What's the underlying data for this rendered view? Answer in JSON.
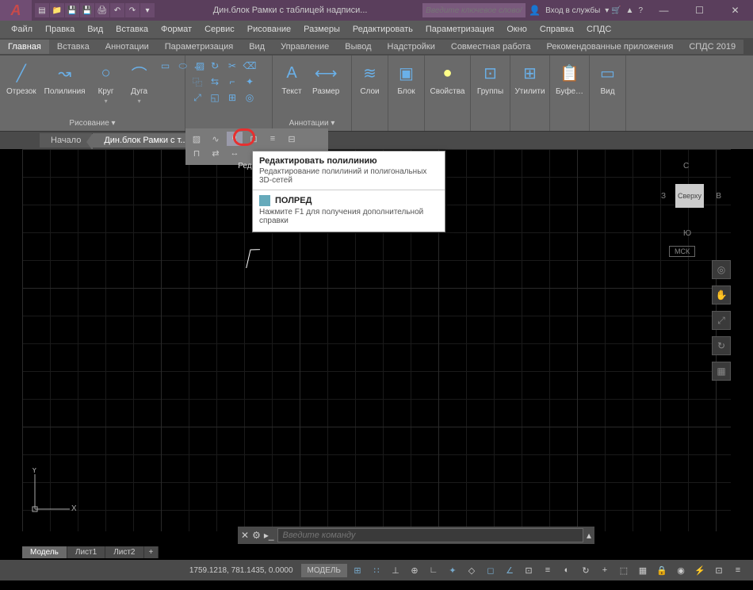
{
  "title": "Дин.блок Рамки с таблицей надписи...",
  "search_placeholder": "Введите ключевое слово/фразу",
  "user_label": "Вход в службы",
  "window": {
    "min": "—",
    "max": "☐",
    "close": "✕"
  },
  "menubar": [
    "Файл",
    "Правка",
    "Вид",
    "Вставка",
    "Формат",
    "Сервис",
    "Рисование",
    "Размеры",
    "Редактировать",
    "Параметризация",
    "Окно",
    "Справка",
    "СПДС"
  ],
  "tabs": [
    "Главная",
    "Вставка",
    "Аннотации",
    "Параметризация",
    "Вид",
    "Управление",
    "Вывод",
    "Надстройки",
    "Совместная работа",
    "Рекомендованные приложения",
    "СПДС 2019"
  ],
  "ribbon": {
    "draw": {
      "segment": "Отрезок",
      "polyline": "Полилиния",
      "circle": "Круг",
      "arc": "Дуга",
      "label": "Рисование ▾"
    },
    "text": "Текст",
    "dim": "Размер",
    "annot": "Аннотации ▾",
    "layer": "Слои",
    "block": "Блок",
    "props": "Свойства",
    "groups": "Группы",
    "utils": "Утилити",
    "clip": "Буфе…",
    "view": "Вид"
  },
  "subribbon_label": "Редакти…",
  "filetabs": {
    "start": "Начало",
    "active": "Дин.блок Рамки с т..."
  },
  "tooltip": {
    "title": "Редактировать полилинию",
    "desc": "Редактирование полилиний и полигональных 3D-сетей",
    "cmd": "ПОЛРЕД",
    "help": "Нажмите F1 для получения дополнительной справки"
  },
  "viewcube": {
    "n": "С",
    "s": "Ю",
    "e": "З",
    "w": "В",
    "top": "Сверху",
    "sys": "МСК"
  },
  "cmd_placeholder": "Введите команду",
  "modeltabs": {
    "model": "Модель",
    "l1": "Лист1",
    "l2": "Лист2",
    "add": "+"
  },
  "status": {
    "coords": "1759.1218, 781.1435, 0.0000",
    "model": "МОДЕЛЬ"
  },
  "ucs": {
    "x": "X",
    "y": "Y"
  }
}
